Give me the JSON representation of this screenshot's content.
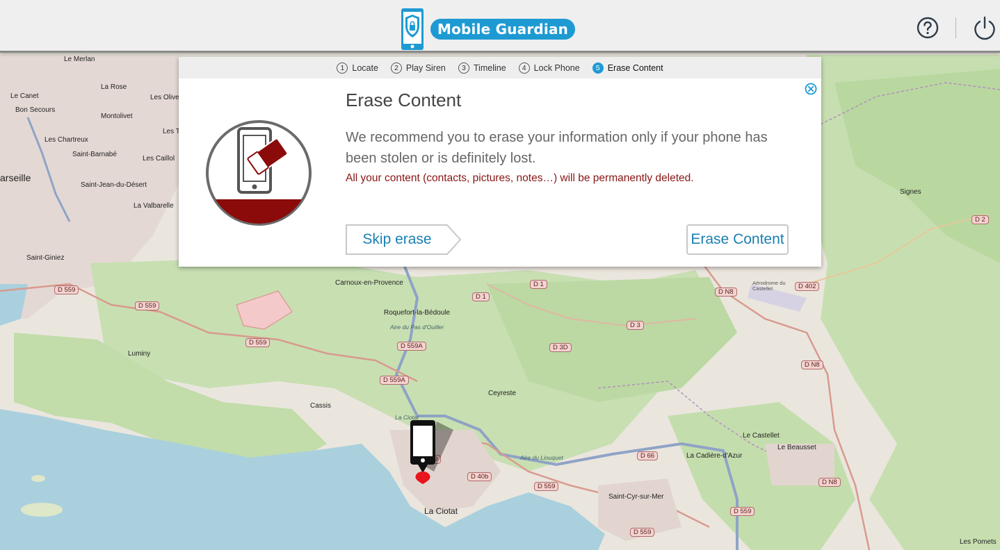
{
  "header": {
    "app_name": "Mobile Guardian",
    "help_icon": "question-circle-icon",
    "power_icon": "power-icon"
  },
  "steps": [
    {
      "num": "1",
      "label": "Locate",
      "active": false
    },
    {
      "num": "2",
      "label": "Play Siren",
      "active": false
    },
    {
      "num": "3",
      "label": "Timeline",
      "active": false
    },
    {
      "num": "4",
      "label": "Lock Phone",
      "active": false
    },
    {
      "num": "5",
      "label": "Erase Content",
      "active": true
    }
  ],
  "dialog": {
    "title": "Erase Content",
    "body": "We recommend you to erase your information only if your phone has been stolen or is definitely lost.",
    "warning": "All your content (contacts, pictures, notes…) will be permanently deleted.",
    "skip_label": "Skip erase",
    "erase_label": "Erase Content"
  },
  "colors": {
    "brand": "#1e9ad3",
    "warning": "#8a1515",
    "illustration_fill": "#8b0a0a"
  },
  "map": {
    "places": [
      {
        "id": "le-merlan",
        "text": "Le Merlan"
      },
      {
        "id": "la-rose",
        "text": "La Rose"
      },
      {
        "id": "le-canet",
        "text": "Le Canet"
      },
      {
        "id": "les-olives",
        "text": "Les Olive"
      },
      {
        "id": "bon-secours",
        "text": "Bon Secours"
      },
      {
        "id": "montolivet",
        "text": "Montolivet"
      },
      {
        "id": "les-chartreux",
        "text": "Les Chartreux"
      },
      {
        "id": "les-t",
        "text": "Les T"
      },
      {
        "id": "saint-barnabe",
        "text": "Saint-Barnabé"
      },
      {
        "id": "les-caillols",
        "text": "Les Caillol"
      },
      {
        "id": "marseille",
        "text": "arseille"
      },
      {
        "id": "saint-jean",
        "text": "Saint-Jean-du-Désert"
      },
      {
        "id": "la-valbarelle",
        "text": "La Valbarelle"
      },
      {
        "id": "saint-giniez",
        "text": "Saint-Giniez"
      },
      {
        "id": "luminy",
        "text": "Luminy"
      },
      {
        "id": "cassis",
        "text": "Cassis"
      },
      {
        "id": "carnoux",
        "text": "Carnoux-en-Provence"
      },
      {
        "id": "roquefort",
        "text": "Roquefort-la-Bédoule"
      },
      {
        "id": "aire-pas",
        "text": "Aire du Pas d'Ouiller"
      },
      {
        "id": "ceyreste",
        "text": "Ceyreste"
      },
      {
        "id": "la-ciotat-small",
        "text": "La Ciotat"
      },
      {
        "id": "aire-liouquet",
        "text": "Aire du Liouquet"
      },
      {
        "id": "la-ciotat",
        "text": "La Ciotat"
      },
      {
        "id": "saint-cyr",
        "text": "Saint-Cyr-sur-Mer"
      },
      {
        "id": "le-castellet",
        "text": "Le Castellet"
      },
      {
        "id": "le-beausset",
        "text": "Le Beausset"
      },
      {
        "id": "la-cadiere",
        "text": "La Cadière-d'Azur"
      },
      {
        "id": "signes",
        "text": "Signes"
      },
      {
        "id": "aerodrome",
        "text": "Aérodrome du Castellet"
      },
      {
        "id": "les-pomets",
        "text": "Les Pomets"
      }
    ],
    "roads": [
      {
        "id": "d559-a",
        "text": "D 559"
      },
      {
        "id": "d559-b",
        "text": "D 559"
      },
      {
        "id": "d559-c",
        "text": "D 559"
      },
      {
        "id": "d559a-a",
        "text": "D 559A"
      },
      {
        "id": "d559a-b",
        "text": "D 559A"
      },
      {
        "id": "d1-a",
        "text": "D 1"
      },
      {
        "id": "d1-b",
        "text": "D 1"
      },
      {
        "id": "d3d",
        "text": "D 3D"
      },
      {
        "id": "d3",
        "text": "D 3"
      },
      {
        "id": "dn8-a",
        "text": "D N8"
      },
      {
        "id": "dn8-b",
        "text": "D N8"
      },
      {
        "id": "dn8-c",
        "text": "D N8"
      },
      {
        "id": "d402",
        "text": "D 402"
      },
      {
        "id": "d2",
        "text": "D 2"
      },
      {
        "id": "d559-d",
        "text": "D 559"
      },
      {
        "id": "d40b",
        "text": "D 40b"
      },
      {
        "id": "d559-e",
        "text": "D 559"
      },
      {
        "id": "d66",
        "text": "D 66"
      },
      {
        "id": "d559-f",
        "text": "D 559"
      },
      {
        "id": "d559-g",
        "text": "D 559"
      }
    ]
  }
}
